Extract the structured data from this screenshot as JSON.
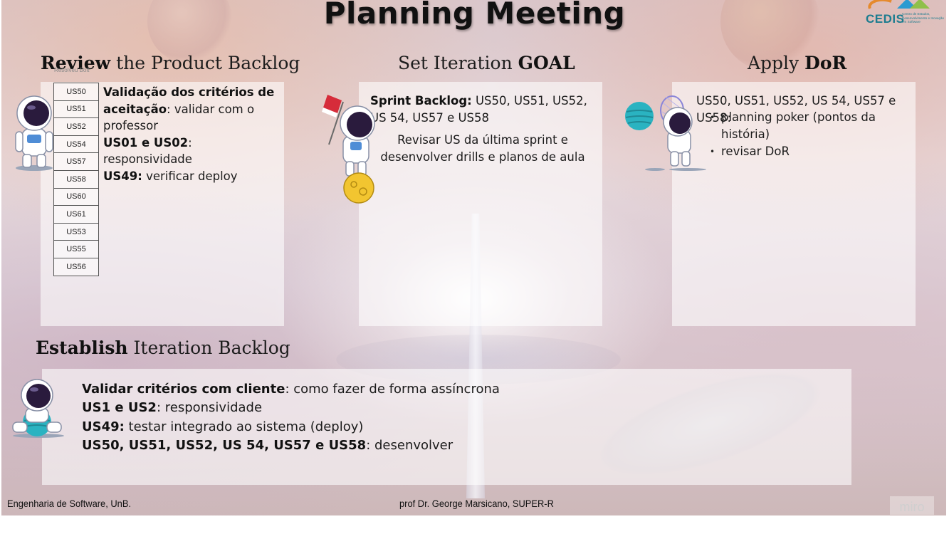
{
  "board": {
    "title": "Planning Meeting",
    "logo": {
      "name": "CEDIS",
      "subtitle": "Centro de Estudos, Desenvolvimento e Inovação em Software"
    }
  },
  "review": {
    "heading_bold": "Review",
    "heading_rest": " the Product Backlog",
    "tiny_label": "Resolveu Bolt",
    "table": [
      "US50",
      "US51",
      "US52",
      "US54",
      "US57",
      "US58",
      "US60",
      "US61",
      "US53",
      "US55",
      "US56"
    ],
    "items": [
      {
        "bold": "Validação dos critérios de aceitação",
        "text": ": validar com o professor"
      },
      {
        "bold": "US01 e US02",
        "text": ": responsividade"
      },
      {
        "bold": "US49:",
        "text": " verificar deploy"
      }
    ]
  },
  "goal": {
    "heading_rest": "Set Iteration ",
    "heading_bold": "GOAL",
    "sprint_bold": "Sprint Backlog:",
    "sprint_text": " US50, US51, US52, US 54, US57 e US58",
    "note": "Revisar US da última sprint e desenvolver drills e planos de aula"
  },
  "dor": {
    "heading_rest": "Apply ",
    "heading_bold": "DoR",
    "intro": "US50, US51, US52, US 54, US57 e US58:",
    "bullets": [
      "planning poker (pontos da história)",
      "revisar DoR"
    ]
  },
  "establish": {
    "heading_bold": "Establish",
    "heading_rest": " Iteration Backlog",
    "items": [
      {
        "bold": "Validar critérios com cliente",
        "text": ": como fazer de forma assíncrona"
      },
      {
        "bold": "US1 e US2",
        "text": ": responsividade"
      },
      {
        "bold": "US49:",
        "text": " testar integrado ao sistema (deploy)"
      },
      {
        "bold": "US50, US51, US52, US 54, US57 e US58",
        "text": ": desenvolver"
      }
    ]
  },
  "footer": {
    "left": "Engenharia de Software, UnB.",
    "center": "prof Dr. George Marsicano, SUPER-R",
    "watermark": "miro"
  }
}
